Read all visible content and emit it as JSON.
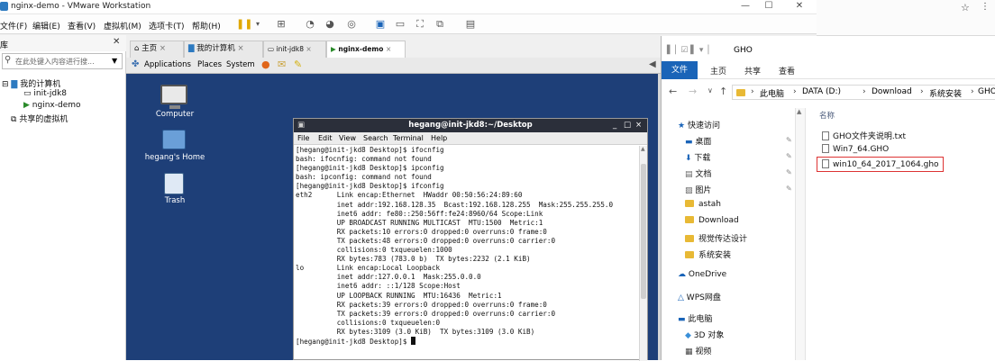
{
  "vmware": {
    "title": "nginx-demo - VMware Workstation",
    "menu": [
      "文件(F)",
      "编辑(E)",
      "查看(V)",
      "虚拟机(M)",
      "选项卡(T)",
      "帮助(H)"
    ],
    "library": {
      "header": "库",
      "search_placeholder": "在此处键入内容进行搜...",
      "tree": [
        "我的计算机",
        "init-jdk8",
        "nginx-demo",
        "共享的虚拟机"
      ]
    },
    "tabs": [
      "主页",
      "我的计算机",
      "init-jdk8",
      "nginx-demo"
    ]
  },
  "guest": {
    "panel_menu": [
      "Applications",
      "Places",
      "System"
    ],
    "desktop_icons": [
      "Computer",
      "hegang's Home",
      "Trash"
    ],
    "terminal": {
      "title": "hegang@init-jkd8:~/Desktop",
      "menu": [
        "File",
        "Edit",
        "View",
        "Search",
        "Terminal",
        "Help"
      ],
      "lines": [
        "[hegang@init-jkd8 Desktop]$ ifocnfig",
        "bash: ifocnfig: command not found",
        "[hegang@init-jkd8 Desktop]$ ipconfig",
        "bash: ipconfig: command not found",
        "[hegang@init-jkd8 Desktop]$ ifconfig",
        "eth2      Link encap:Ethernet  HWaddr 00:50:56:24:89:60",
        "          inet addr:192.168.128.35  Bcast:192.168.128.255  Mask:255.255.255.0",
        "          inet6 addr: fe80::250:56ff:fe24:8960/64 Scope:Link",
        "          UP BROADCAST RUNNING MULTICAST  MTU:1500  Metric:1",
        "          RX packets:10 errors:0 dropped:0 overruns:0 frame:0",
        "          TX packets:48 errors:0 dropped:0 overruns:0 carrier:0",
        "          collisions:0 txqueuelen:1000",
        "          RX bytes:783 (783.0 b)  TX bytes:2232 (2.1 KiB)",
        "",
        "lo        Link encap:Local Loopback",
        "          inet addr:127.0.0.1  Mask:255.0.0.0",
        "          inet6 addr: ::1/128 Scope:Host",
        "          UP LOOPBACK RUNNING  MTU:16436  Metric:1",
        "          RX packets:39 errors:0 dropped:0 overruns:0 frame:0",
        "          TX packets:39 errors:0 dropped:0 overruns:0 carrier:0",
        "          collisions:0 txqueuelen:0",
        "          RX bytes:3109 (3.0 KiB)  TX bytes:3109 (3.0 KiB)",
        "",
        "[hegang@init-jkd8 Desktop]$ "
      ]
    }
  },
  "explorer": {
    "title": "GHO",
    "ribbon_tabs": [
      "文件",
      "主页",
      "共享",
      "查看"
    ],
    "breadcrumb": [
      "此电脑",
      "DATA (D:)",
      "Download",
      "系统安装",
      "GHO"
    ],
    "nav": [
      "快速访问",
      "桌面",
      "下载",
      "文档",
      "图片",
      "astah",
      "Download",
      "视觉传达设计",
      "系统安装",
      "OneDrive",
      "WPS网盘",
      "此电脑",
      "3D 对象",
      "视频"
    ],
    "column_header": "名称",
    "files": [
      "GHO文件夹说明.txt",
      "Win7_64.GHO",
      "win10_64_2017_1064.gho"
    ]
  }
}
